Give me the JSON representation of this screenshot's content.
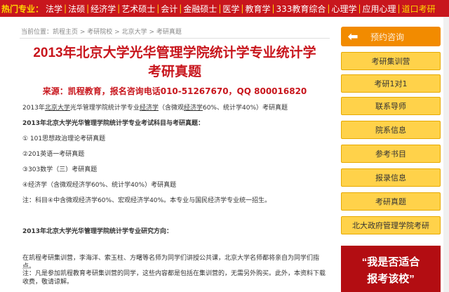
{
  "topnav": {
    "hot_label": "热门专业：",
    "items": [
      "法学",
      "法硕",
      "经济学",
      "艺术硕士",
      "会计",
      "金融硕士",
      "医学",
      "教育学",
      "333教育综合",
      "心理学",
      "应用心理"
    ],
    "last": "道口考研"
  },
  "breadcrumb": {
    "prefix": "当前位置：",
    "items": [
      "凯程主页",
      "考研院校",
      "北京大学",
      "考研真题"
    ],
    "sep": " > "
  },
  "article": {
    "title_line1": "2013年北京大学光华管理学院统计学专业统计学",
    "title_line2": "考研真题",
    "source": "来源：凯程教育，报名咨询电话010-51267670，QQ 800016820",
    "intro_pre": "2013年",
    "intro_link1": "北京大学",
    "intro_mid": "光华管理学院统计学专业",
    "intro_link2": "经济学",
    "intro_mid2": "（含微观",
    "intro_link3": "经济学",
    "intro_post": "60%、统计学40%）考研真题",
    "subjects_heading": "2013年北京大学光华管理学院统计学专业考试科目与考研真题：",
    "subjects": [
      "① 101思想政治理论考研真题",
      "②201英语一考研真题",
      "③303数学（三）考研真题",
      "④经济学（含微观经济学60%、统计学40%）考研真题"
    ],
    "note": "注：科目④中含微观经济学60%、宏观经济学40%。本专业与国民经济学专业统一招生。",
    "direction_heading": "2013年北京大学光华管理学院统计学专业研究方向：",
    "para1": "在凯程考研集训营，李海洋、索玉柱、方曙等名师为同学们讲授公共课，北京大学名师都将亲自为同学们指点。",
    "para2": "注：凡是参加凯程教育考研集训营的同学，这些内容都是包括在集训营的，无需另外购买。此外，本资料下载收费，敬请谅解。"
  },
  "sidebar": {
    "back_label": "预约咨询",
    "buttons": [
      "考研集训营",
      "考研1对1",
      "联系导师",
      "院系信息",
      "参考书目",
      "报录信息",
      "考研真题",
      "北大政府管理学院考研"
    ]
  },
  "banner": {
    "line1": "“我是否适合",
    "line2": "报考该校”"
  },
  "colors": {
    "brand_red": "#c8161d",
    "accent_yellow": "#ffd24a",
    "accent_orange": "#f28b00"
  }
}
